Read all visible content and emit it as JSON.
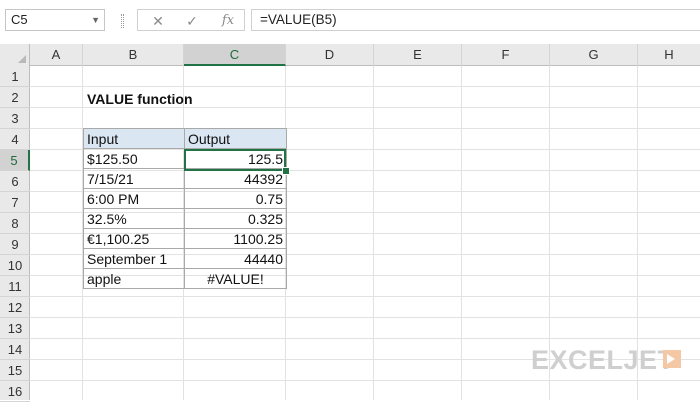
{
  "formula_bar": {
    "name_box": "C5",
    "cancel_icon": "✕",
    "enter_icon": "✓",
    "function_icon": "fx",
    "formula": "=VALUE(B5)"
  },
  "columns": [
    "A",
    "B",
    "C",
    "D",
    "E",
    "F",
    "G",
    "H"
  ],
  "selected_column": "C",
  "rows": [
    "1",
    "2",
    "3",
    "4",
    "5",
    "6",
    "7",
    "8",
    "9",
    "10",
    "11",
    "12",
    "13",
    "14",
    "15",
    "16"
  ],
  "selected_row": "5",
  "sheet": {
    "title": "VALUE function",
    "headers": [
      "Input",
      "Output"
    ],
    "table": [
      {
        "input": "$125.50",
        "output": "125.5"
      },
      {
        "input": "7/15/21",
        "output": "44392"
      },
      {
        "input": "6:00 PM",
        "output": "0.75"
      },
      {
        "input": "32.5%",
        "output": "0.325"
      },
      {
        "input": "€1,100.25",
        "output": "1100.25"
      },
      {
        "input": "September 1",
        "output": "44440"
      },
      {
        "input": "apple",
        "output": "#VALUE!"
      }
    ]
  },
  "logo": {
    "text": "EXCELJET"
  },
  "colors": {
    "selection": "#217346",
    "header_fill": "#dae6f2",
    "watermark": "#cfcfcf",
    "logo_accent": "#f4c7a5"
  }
}
